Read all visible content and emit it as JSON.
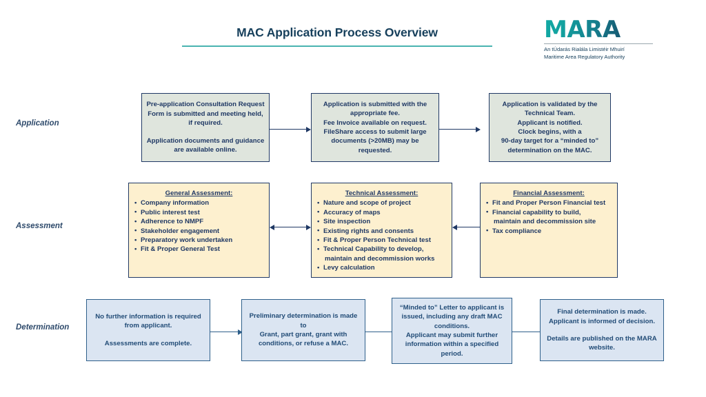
{
  "header": {
    "title": "MAC Application Process Overview",
    "accent_rule_color": "#49b3b0",
    "title_color": "#17405c"
  },
  "logo": {
    "wordmark": "MARA",
    "subtitle_irish": "An tÚdarás Rialála Limistéir Mhuirí",
    "subtitle_english": "Maritime Area Regulatory Authority",
    "gradient_from": "#12a9a4",
    "gradient_to": "#153b56"
  },
  "rows": [
    {
      "label": "Application"
    },
    {
      "label": "Assessment"
    },
    {
      "label": "Determination"
    }
  ],
  "application_stage": {
    "fill": "#dfe5dd",
    "border": "#1f3864",
    "boxes": [
      {
        "para1": "Pre-application Consultation Request Form is submitted and meeting held, if required.",
        "para2": "Application documents and guidance are available online."
      },
      {
        "para1": "Application is submitted with the appropriate fee.",
        "para2": "Fee Invoice available on request.",
        "para3": "FileShare access to submit large documents (>20MB) may be requested."
      },
      {
        "para1": "Application is validated by the Technical Team.",
        "para2": "Applicant is notified.",
        "para3": "Clock begins, with a",
        "para4": "90-day target for a “minded to” determination on the MAC."
      }
    ]
  },
  "assessment_stage": {
    "fill": "#fdf0cf",
    "border": "#1f3864",
    "boxes": [
      {
        "heading": "General Assessment:",
        "items": [
          "Company information",
          "Public interest test",
          "Adherence to NMPF",
          "Stakeholder engagement",
          "Preparatory work undertaken",
          "Fit & Proper General Test"
        ]
      },
      {
        "heading": "Technical Assessment:",
        "items": [
          "Nature and scope of project",
          "Accuracy of maps",
          "Site inspection",
          "Existing rights and consents",
          "Fit & Proper Person Technical test",
          "Technical Capability to develop,",
          "Levy calculation"
        ],
        "item_continuations": {
          "5": "maintain and decommission works"
        }
      },
      {
        "heading": "Financial Assessment:",
        "items": [
          "Fit and Proper Person Financial test",
          "Financial capability to build,",
          "Tax compliance"
        ],
        "item_continuations": {
          "1": "maintain and decommission site"
        }
      }
    ]
  },
  "determination_stage": {
    "fill": "#dbe5f2",
    "border": "#2e5f8a",
    "boxes": [
      {
        "para1": "No further information is required from applicant.",
        "para2": "Assessments are complete."
      },
      {
        "para1": "Preliminary determination is made to",
        "para2": "Grant, part grant, grant with conditions, or refuse a MAC."
      },
      {
        "para1": "“Minded to” Letter to applicant is issued, including any draft MAC conditions.",
        "para2": "Applicant may submit further information within a specified period."
      },
      {
        "para1": "Final determination is made. Applicant is informed of decision.",
        "para2": "Details are published on the MARA website."
      }
    ]
  },
  "connectors": {
    "application_arrows": 2,
    "assessment_arrows": 2,
    "assessment_arrow_type": "double-headed",
    "determination_arrows": 3,
    "arrow_color": "#1f3864"
  }
}
